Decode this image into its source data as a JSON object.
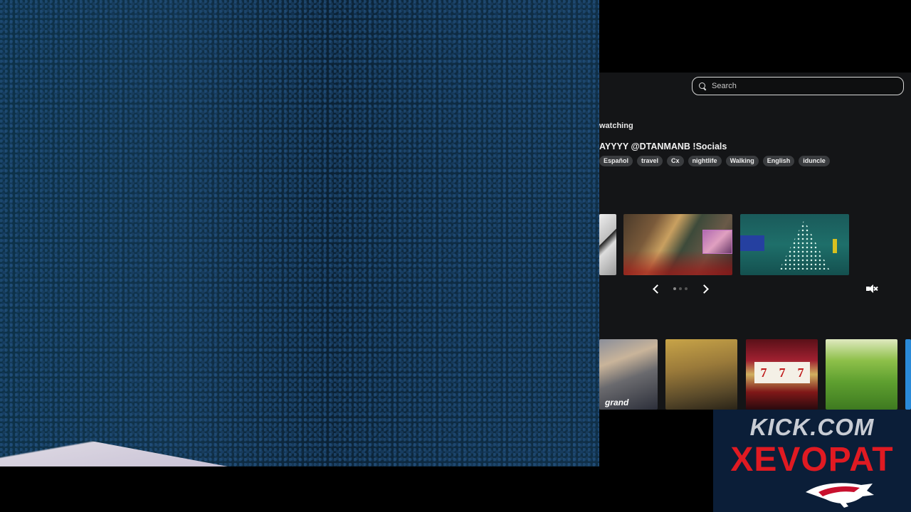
{
  "search": {
    "placeholder": "Search",
    "icon": "search-icon"
  },
  "stream": {
    "watching_label": "watching",
    "title": "AYYYY @DTANMANB !Socials",
    "tags": [
      "Español",
      "travel",
      "Cx",
      "nightlife",
      "Walking",
      "English",
      "iduncle"
    ]
  },
  "carousel": {
    "dots_count": 3,
    "active_dot": 0,
    "prev_icon": "chevron-left-icon",
    "next_icon": "chevron-right-icon",
    "mute_icon": "volume-muted-icon"
  },
  "categories": [
    {
      "label": "grand"
    },
    {
      "label": ""
    },
    {
      "label": "777"
    },
    {
      "label": ""
    }
  ],
  "overlay": {
    "site": "KICK.COM",
    "channel": "XEVOPAT",
    "colors": {
      "site": "#c8ccd4",
      "channel": "#e01a22",
      "background": "#0b1e38"
    }
  }
}
